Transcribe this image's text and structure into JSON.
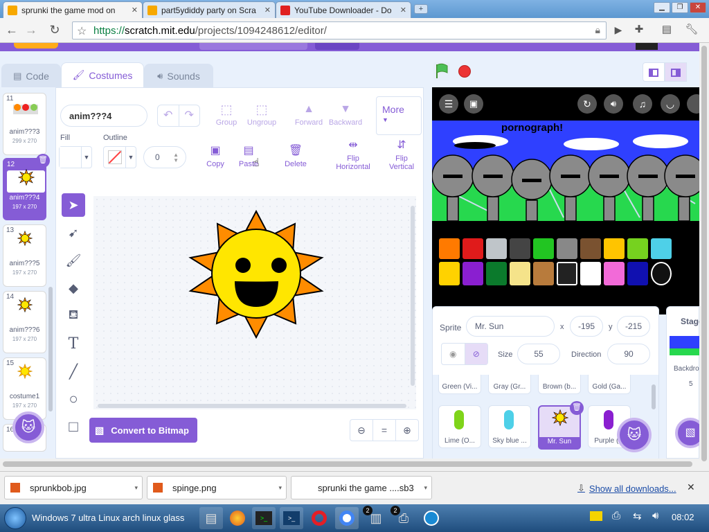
{
  "browser": {
    "tabs": [
      {
        "title": "sprunki the game mod on",
        "active": true
      },
      {
        "title": "part5ydiddy party on Scra",
        "active": false
      },
      {
        "title": "YouTube Downloader - Do",
        "active": false
      }
    ],
    "url_scheme": "https://",
    "url_host": "scratch.mit.edu",
    "url_path": "/projects/1094248612/editor/"
  },
  "scratch": {
    "tabs": {
      "code": "Code",
      "costumes": "Costumes",
      "sounds": "Sounds"
    },
    "costumes": [
      {
        "num": "11",
        "name": "anim???3",
        "size": "299 x 270",
        "selected": false
      },
      {
        "num": "12",
        "name": "anim???4",
        "size": "197 x 270",
        "selected": true
      },
      {
        "num": "13",
        "name": "anim???5",
        "size": "197 x 270",
        "selected": false
      },
      {
        "num": "14",
        "name": "anim???6",
        "size": "197 x 270",
        "selected": false
      },
      {
        "num": "15",
        "name": "costume1",
        "size": "197 x 270",
        "selected": false
      },
      {
        "num": "16",
        "name": "",
        "size": "",
        "selected": false
      }
    ],
    "editor": {
      "costume_name": "anim???4",
      "group": "Group",
      "ungroup": "Ungroup",
      "forward": "Forward",
      "backward": "Backward",
      "more": "More",
      "fill_label": "Fill",
      "outline_label": "Outline",
      "outline_width": "0",
      "copy": "Copy",
      "paste": "Paste",
      "delete": "Delete",
      "flip_h_1": "Flip",
      "flip_h_2": "Horizontal",
      "flip_v_1": "Flip",
      "flip_v_2": "Vertical",
      "convert": "Convert to Bitmap",
      "zoom_reset": "="
    },
    "stage": {
      "title_text": "pornograph!"
    },
    "sprite_info": {
      "sprite_label": "Sprite",
      "sprite_name": "Mr. Sun",
      "x_label": "x",
      "x": "-195",
      "y_label": "y",
      "y": "-215",
      "size_label": "Size",
      "size": "55",
      "direction_label": "Direction",
      "direction": "90",
      "stage_label": "Stage",
      "backdrops_label": "Backdrop",
      "backdrops_count": "5"
    },
    "sprites_row1": [
      "Green (Vi...",
      "Gray (Gr...",
      "Brown (b...",
      "Gold (Ga..."
    ],
    "sprites_row2": [
      {
        "name": "Lime (O...",
        "color": "#7fd41a"
      },
      {
        "name": "Sky blue ...",
        "color": "#4ed0e8"
      },
      {
        "name": "Mr. Sun",
        "color": "#ffd200",
        "selected": true
      },
      {
        "name": "Purple (...",
        "color": "#8a1fd0"
      }
    ]
  },
  "downloads": {
    "items": [
      "sprunkbob.jpg",
      "spinge.png",
      "sprunki the game ....sb3"
    ],
    "show_all": "Show all downloads..."
  },
  "taskbar": {
    "start_text": "Windows 7 ultra Linux arch linux glass",
    "time": "08:02",
    "badge1": "2",
    "badge2": "2"
  },
  "colors": {
    "scratch_purple": "#855cd6",
    "scratch_bg": "#e9f1fc",
    "sun_yellow": "#ffe600",
    "sun_orange": "#ff8c00",
    "stage_blue": "#2f40ff"
  }
}
